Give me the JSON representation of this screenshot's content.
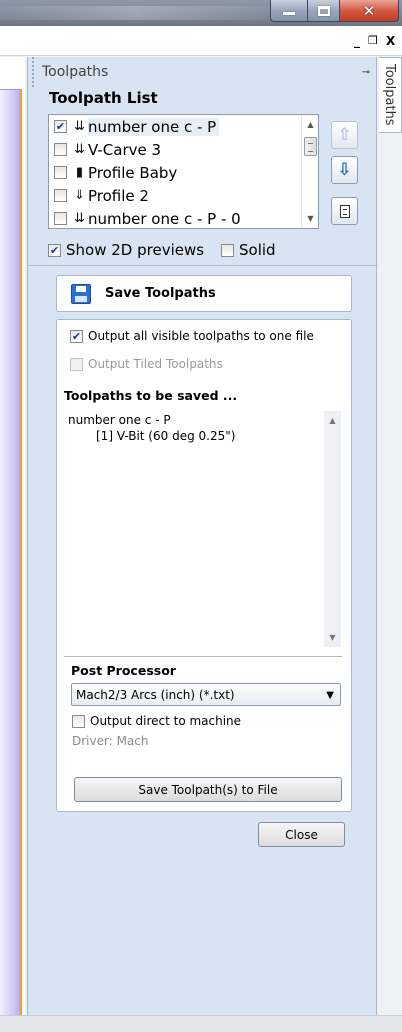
{
  "window": {
    "minimize_icon": "minimize-icon",
    "maximize_icon": "restore-icon",
    "close_icon": "close-icon"
  },
  "mdi": {
    "minimize": "_",
    "restore": "❒",
    "close": "X"
  },
  "panel": {
    "title": "Toolpaths",
    "side_tab": "Toolpaths",
    "pin": "‒▫"
  },
  "toolpath_list": {
    "title": "Toolpath List",
    "items": [
      {
        "label": "number one c - P",
        "checked": true,
        "icon": "vbit-toolpath-icon",
        "selected": true
      },
      {
        "label": "V-Carve 3",
        "checked": false,
        "icon": "vbit-toolpath-icon"
      },
      {
        "label": "Profile Baby",
        "checked": false,
        "icon": "profile-toolpath-icon"
      },
      {
        "label": "Profile 2",
        "checked": false,
        "icon": "profile-toolpath-icon"
      },
      {
        "label": "number one c - P - 0",
        "checked": false,
        "icon": "vbit-toolpath-icon"
      }
    ]
  },
  "options": {
    "show_2d_previews": "Show 2D previews",
    "show_2d_checked": true,
    "solid": "Solid",
    "solid_checked": false
  },
  "save": {
    "title": "Save Toolpaths",
    "output_all_visible": "Output all visible toolpaths to one file",
    "output_tiled": "Output Tiled Toolpaths",
    "to_be_saved_title": "Toolpaths to be saved ...",
    "saved_lines": [
      "number one c - P",
      "[1] V-Bit (60 deg 0.25\")"
    ],
    "post_processor_title": "Post Processor",
    "post_processor_value": "Mach2/3 Arcs (inch) (*.txt)",
    "output_direct": "Output direct to machine",
    "driver": "Driver: Mach",
    "save_button": "Save Toolpath(s) to File",
    "close_button": "Close"
  }
}
